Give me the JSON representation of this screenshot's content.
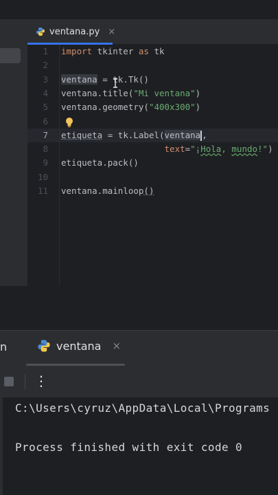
{
  "editor_tab": {
    "filename": "ventana.py",
    "close_glyph": "×",
    "icon": "python-icon"
  },
  "code_lines": [
    {
      "n": "1",
      "parts": [
        [
          "kw",
          "import"
        ],
        [
          "t",
          " tkinter "
        ],
        [
          "kw",
          "as"
        ],
        [
          "t",
          " tk"
        ]
      ]
    },
    {
      "n": "2",
      "parts": []
    },
    {
      "n": "3",
      "parts": [
        [
          "var",
          "ventana"
        ],
        [
          "t",
          " = tk.Tk()"
        ]
      ]
    },
    {
      "n": "4",
      "parts": [
        [
          "t",
          "ventana.title("
        ],
        [
          "str",
          "\"Mi ventana\""
        ],
        [
          "t",
          ")"
        ]
      ]
    },
    {
      "n": "5",
      "parts": [
        [
          "t",
          "ventana.geometry("
        ],
        [
          "str",
          "\"400x300\""
        ],
        [
          "t",
          ")"
        ]
      ]
    },
    {
      "n": "6",
      "parts": []
    },
    {
      "n": "7",
      "current": true,
      "parts": [
        [
          "u",
          "etiqueta"
        ],
        [
          "t",
          " = tk.Label("
        ],
        [
          "var",
          "ventana"
        ],
        [
          "cursor",
          ""
        ],
        [
          "t",
          ","
        ]
      ]
    },
    {
      "n": "8",
      "parts": [
        [
          "t",
          "                    "
        ],
        [
          "kw",
          "text"
        ],
        [
          "t",
          "="
        ],
        [
          "str",
          "\"¡"
        ],
        [
          "wavy",
          "Hola"
        ],
        [
          "str",
          ", "
        ],
        [
          "wavy",
          "mundo"
        ],
        [
          "str",
          "!\""
        ],
        [
          "t",
          ")"
        ]
      ]
    },
    {
      "n": "9",
      "parts": [
        [
          "t",
          "etiqueta.pack()"
        ]
      ]
    },
    {
      "n": "10",
      "parts": []
    },
    {
      "n": "11",
      "parts": [
        [
          "t",
          "ventana.mainloop"
        ],
        [
          "uline",
          "()"
        ]
      ]
    }
  ],
  "run_panel": {
    "left_label": "n",
    "tab_title": "ventana",
    "close_glyph": "×",
    "more_glyph": "⋮"
  },
  "console": {
    "path_line": "C:\\Users\\cyruz\\AppData\\Local\\Programs",
    "exit_line": "Process finished with exit code 0"
  },
  "colors": {
    "accent": "#3574f0",
    "keyword": "#cf8e6d",
    "string": "#6aab73",
    "bulb": "#f2c55c"
  }
}
